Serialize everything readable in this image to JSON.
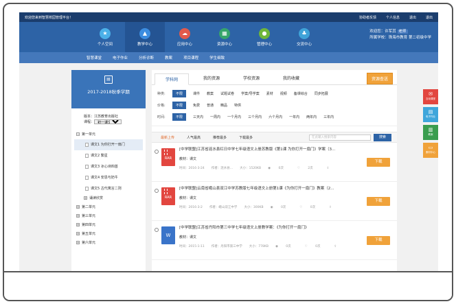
{
  "topbar": {
    "welcome": "欢迎您来到智慧校园管理平台！",
    "links": [
      "协助者反馈",
      "个人信息",
      "退出",
      "退出"
    ]
  },
  "nav": [
    {
      "label": "个人空间",
      "icon": "star-icon",
      "color": "#4bb0e8"
    },
    {
      "label": "教学中心",
      "icon": "graduation-cap-icon",
      "color": "#3c8de0"
    },
    {
      "label": "应用中心",
      "icon": "cloud-icon",
      "color": "#e25a4c"
    },
    {
      "label": "资源中心",
      "icon": "grid-icon",
      "color": "#37a56b"
    },
    {
      "label": "管理中心",
      "icon": "user-icon",
      "color": "#6fb63a"
    },
    {
      "label": "交流中心",
      "icon": "people-icon",
      "color": "#3fa3d8"
    }
  ],
  "user": {
    "prefix": "欢迎您：",
    "name": "许军其",
    "badge": "老师",
    "school": "所属学校：珠海市教育 第二初级中学"
  },
  "subnav": [
    "智慧课堂",
    "电子作业",
    "分析诊断",
    "教案",
    "项目课程",
    "学生细致"
  ],
  "left": {
    "term": "2017-2018秋季学期",
    "version_label": "版本：",
    "version": "江苏教育出版社",
    "course_label": "课程：",
    "course": "初一课文",
    "tree": [
      {
        "type": "unit",
        "label": "第一单元",
        "pm": "−"
      },
      {
        "type": "lesson",
        "label": "课文1 为你打开一扇门",
        "sel": true
      },
      {
        "type": "lesson",
        "label": "课文2 繁星"
      },
      {
        "type": "lesson",
        "label": "课文3 冰心诗四首"
      },
      {
        "type": "lesson",
        "label": "课文4 安恩与奶牛"
      },
      {
        "type": "lesson",
        "label": "课文5 古代寓言二则"
      },
      {
        "type": "unit",
        "label": "诵读欣赏",
        "pm": "+",
        "sub": true
      },
      {
        "type": "unit",
        "label": "第二单元",
        "pm": "+"
      },
      {
        "type": "unit",
        "label": "第三单元",
        "pm": "+"
      },
      {
        "type": "unit",
        "label": "第四单元",
        "pm": "+"
      },
      {
        "type": "unit",
        "label": "第五单元",
        "pm": "+"
      },
      {
        "type": "unit",
        "label": "第六单元",
        "pm": "+"
      }
    ]
  },
  "tabs": [
    "学科网",
    "我的资源",
    "学校资源",
    "我的收藏"
  ],
  "upload": "资源查送",
  "filters": [
    {
      "label": "种类:",
      "opts": [
        "不限",
        "课件",
        "教案",
        "试题试卷",
        "学案/导学案",
        "素材",
        "视频",
        "备课综合",
        "同步拓展"
      ]
    },
    {
      "label": "价格:",
      "opts": [
        "不限",
        "免费",
        "普通",
        "精品",
        "特供"
      ]
    },
    {
      "label": "时间:",
      "opts": [
        "不限",
        "三天内",
        "一周内",
        "一个月内",
        "三个月内",
        "六个月内",
        "一年内",
        "两年内",
        "三年内"
      ]
    }
  ],
  "sort": [
    "最新上传",
    "人气最高",
    "推荐最多",
    "下载最多"
  ],
  "search_placeholder": "在此输入搜索内容",
  "search_btn": "搜索",
  "results": [
    {
      "type": "RAR",
      "title": "[中学联盟]江苏省涟水县红日中学七年级语文上册苏教版《第1课 为你打开一扇门》学案（3...",
      "material": "教材：课文",
      "time": "时间：2016-3-24",
      "author": "作者：涟水县...",
      "size": "大小：1520KB",
      "views": "0次",
      "likes": "2次",
      "dl": "下载"
    },
    {
      "type": "RAR",
      "title": "[中学联盟]云南省峨山县双江中学苏教版七年级语文上册第1课《为你打开一扇门》教案（2...",
      "material": "教材：课文",
      "time": "时间：2016-3-2",
      "author": "作者：峨山双江中学",
      "size": "大小：300KB",
      "views": "0次",
      "likes": "0次",
      "dl": "下载"
    },
    {
      "type": "W",
      "title": "[中学联盟]江苏省丹阳市第三中学七年级语文上册教学案：《为你打开一扇门》",
      "material": "教材：课文",
      "time": "时间：2015-1-11",
      "author": "作者：丹阳市第三中学",
      "size": "大小：778KB",
      "views": "0次",
      "likes": "0次",
      "dl": "下载"
    }
  ],
  "side": [
    {
      "label": "互动课堂",
      "icon": "chat-icon",
      "color": "#e2463f"
    },
    {
      "label": "电子作业",
      "icon": "doc-icon",
      "color": "#3ea6db"
    },
    {
      "label": "教案",
      "icon": "book-icon",
      "color": "#3a9d4f"
    },
    {
      "label": "素材中心",
      "icon": "folder-icon",
      "color": "#f0a23a"
    }
  ]
}
